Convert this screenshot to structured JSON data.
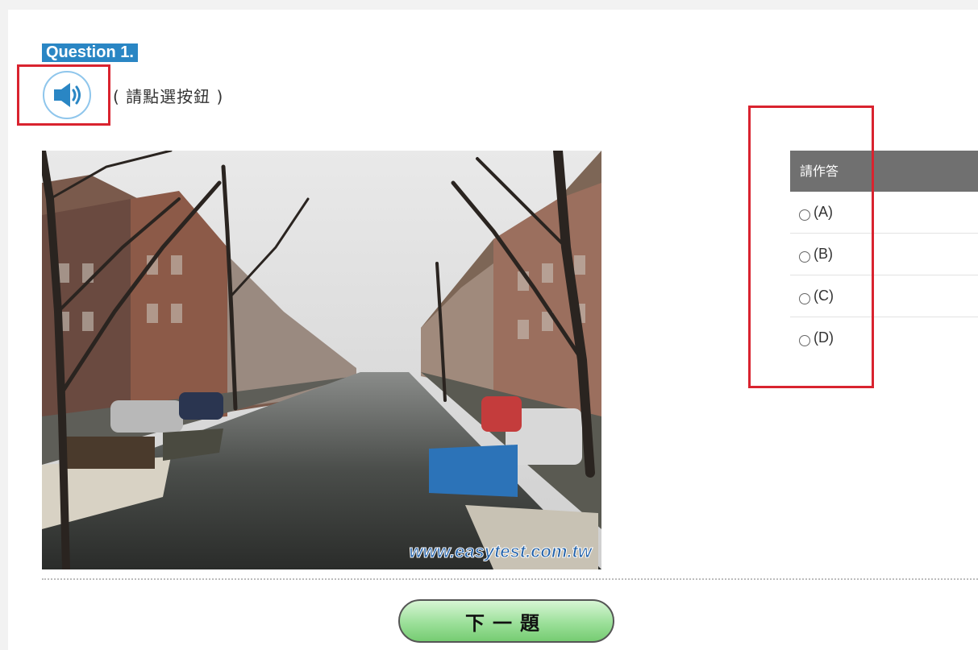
{
  "question": {
    "label": "Question 1."
  },
  "audio": {
    "icon": "speaker-icon",
    "hint": "( 請點選按鈕 )"
  },
  "photo": {
    "watermark": "www.easytest.com.tw"
  },
  "answers": {
    "header": "請作答",
    "options": [
      {
        "label": "(A)",
        "selected": false
      },
      {
        "label": "(B)",
        "selected": false
      },
      {
        "label": "(C)",
        "selected": false
      },
      {
        "label": "(D)",
        "selected": false
      }
    ]
  },
  "next": {
    "label": "下一題"
  },
  "colors": {
    "accent": "#2a86c4",
    "highlight": "#d9232f",
    "header_bg": "#707070",
    "next_button": "#9ce09a"
  }
}
